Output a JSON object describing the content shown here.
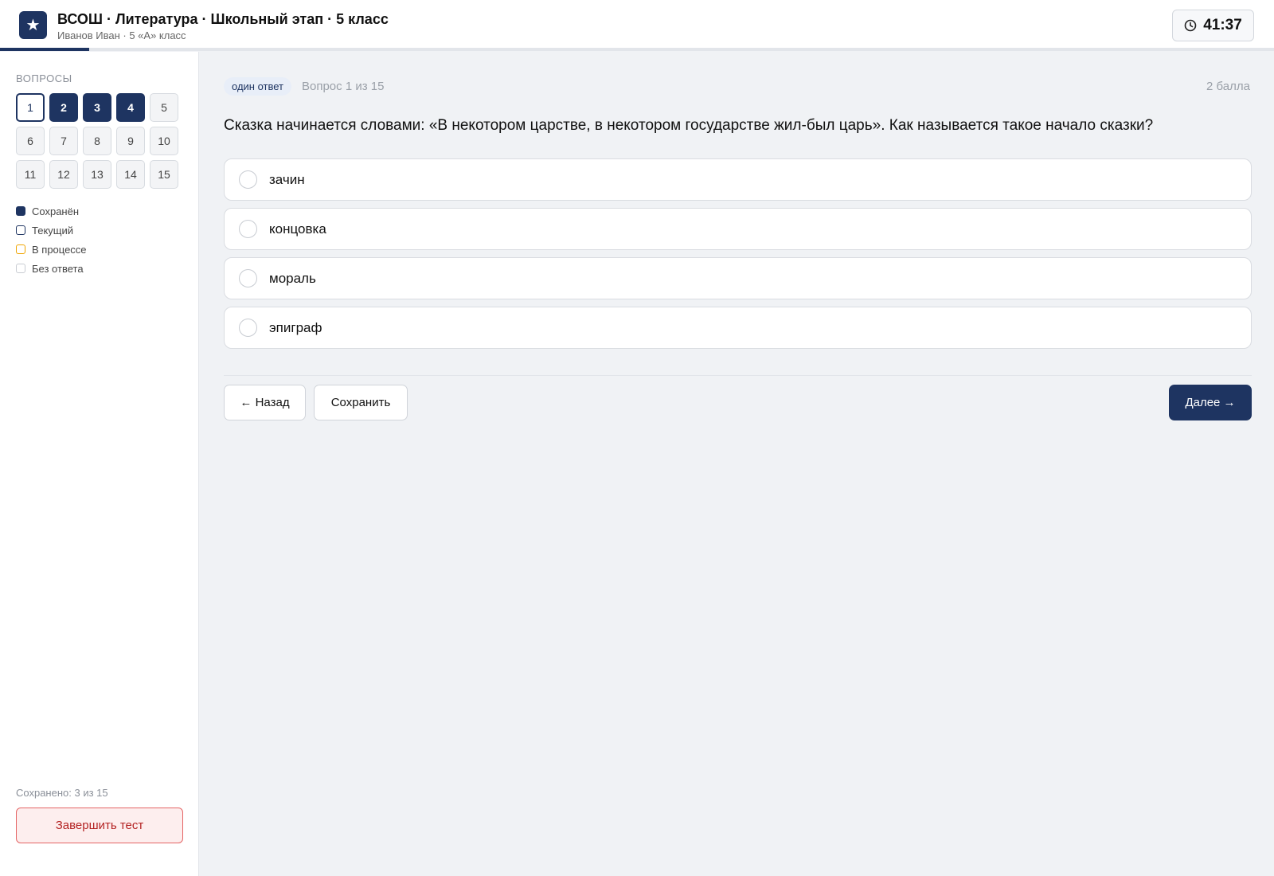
{
  "header": {
    "logo_glyph": "★",
    "title": "ВСОШ · Литература · Школьный этап · 5 класс",
    "subtitle": "Иванов Иван · 5 «А» класс",
    "timer": "41:37",
    "progress_fraction": 0.07
  },
  "sidebar": {
    "heading": "ВОПРОСЫ",
    "questions": [
      {
        "num": "1",
        "state": "current"
      },
      {
        "num": "2",
        "state": "saved"
      },
      {
        "num": "3",
        "state": "saved"
      },
      {
        "num": "4",
        "state": "saved"
      },
      {
        "num": "5",
        "state": "empty"
      },
      {
        "num": "6",
        "state": "empty"
      },
      {
        "num": "7",
        "state": "empty"
      },
      {
        "num": "8",
        "state": "empty"
      },
      {
        "num": "9",
        "state": "empty"
      },
      {
        "num": "10",
        "state": "empty"
      },
      {
        "num": "11",
        "state": "empty"
      },
      {
        "num": "12",
        "state": "empty"
      },
      {
        "num": "13",
        "state": "empty"
      },
      {
        "num": "14",
        "state": "empty"
      },
      {
        "num": "15",
        "state": "empty"
      }
    ],
    "legend": [
      {
        "label": "Сохранён",
        "color": "#1e3461",
        "style": "filled"
      },
      {
        "label": "Текущий",
        "color": "#1e3461",
        "style": "outline"
      },
      {
        "label": "В процессе",
        "color": "#f0a500",
        "style": "outline"
      },
      {
        "label": "Без ответа",
        "color": "#c8ccd2",
        "style": "outline"
      }
    ],
    "saved_count": "Сохранено: 3 из 15",
    "finish_label": "Завершить тест"
  },
  "question": {
    "type_badge": "один ответ",
    "counter": "Вопрос 1 из 15",
    "points": "2 балла",
    "text": "Сказка начинается словами: «В некотором царстве, в некотором государстве жил-был царь». Как называется такое начало сказки?",
    "options": [
      "зачин",
      "концовка",
      "мораль",
      "эпиграф"
    ]
  },
  "nav": {
    "back_label": "← Назад",
    "save_label": "Сохранить",
    "next_label": "Далее →"
  },
  "colors": {
    "accent": "#1e3461",
    "danger": "#e46464",
    "in_progress": "#f0a500"
  }
}
